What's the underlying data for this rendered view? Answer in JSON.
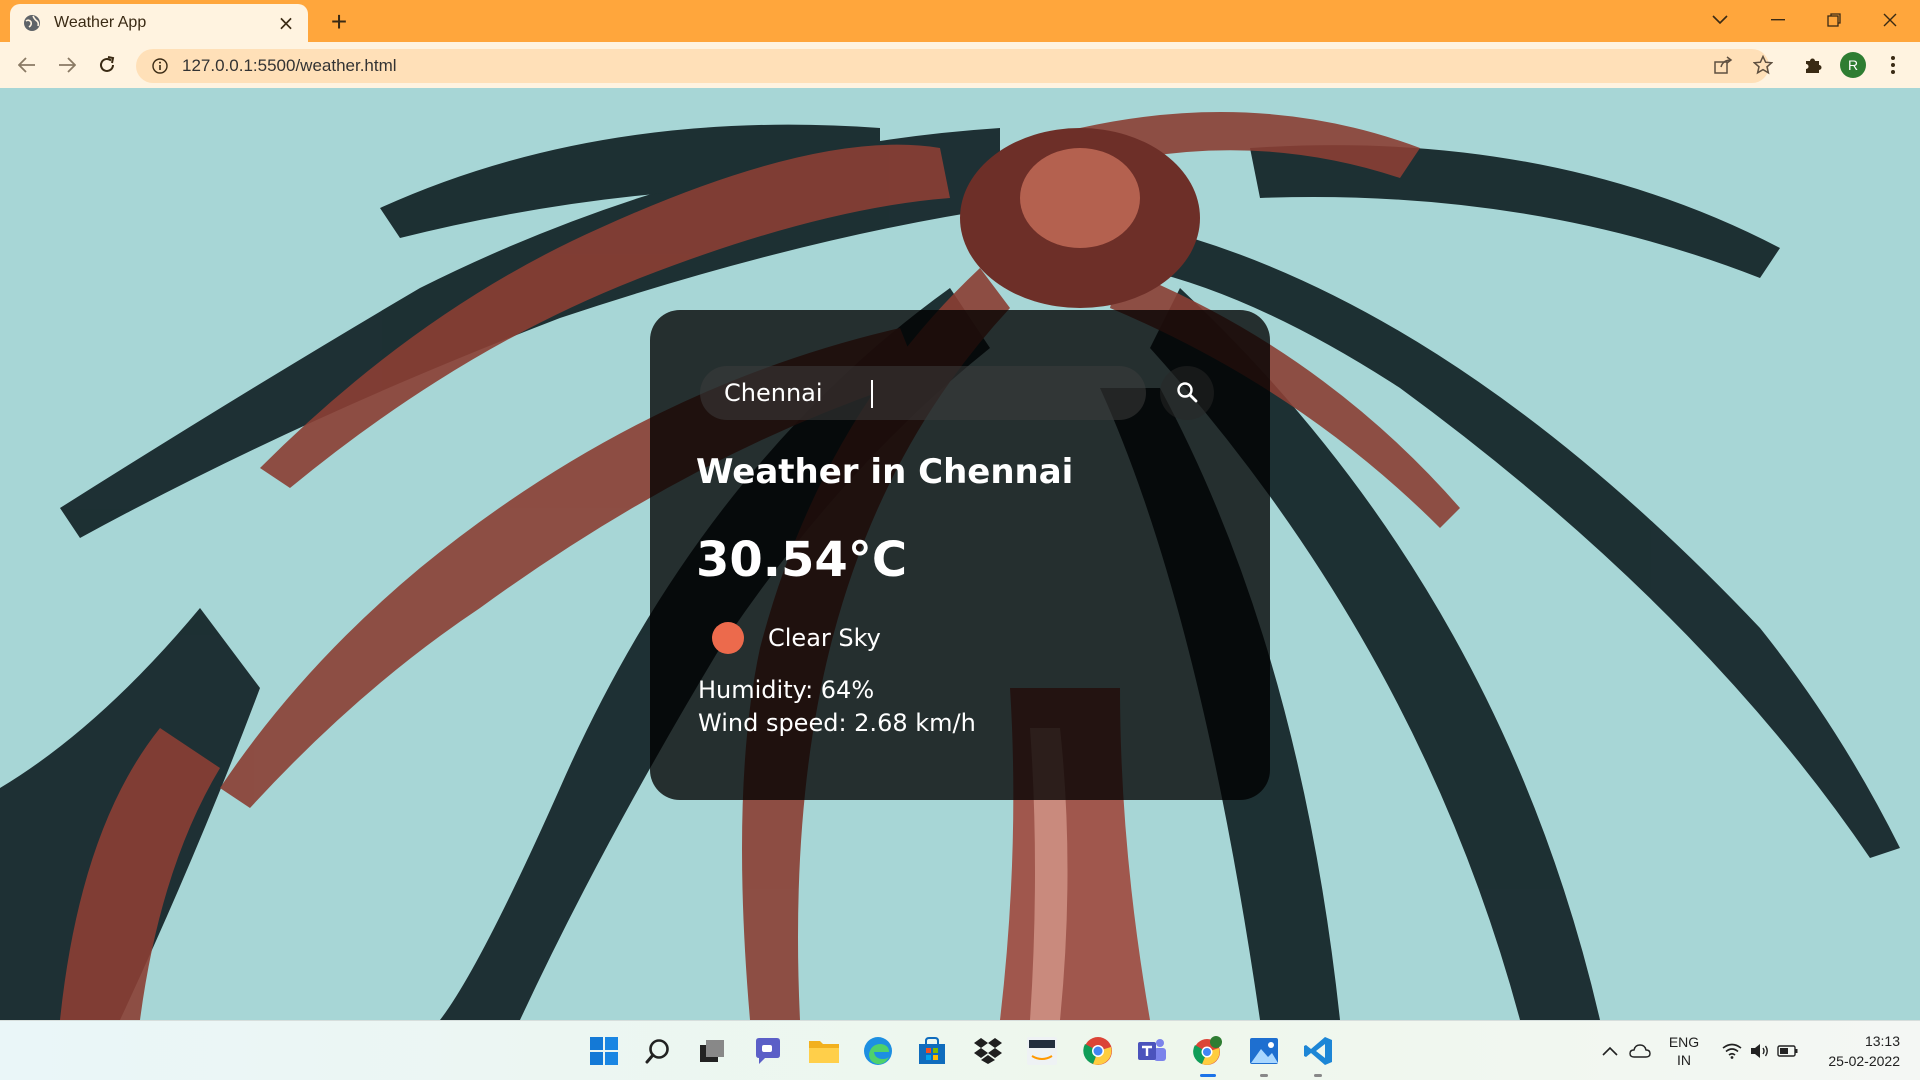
{
  "browser": {
    "tab_title": "Weather App",
    "tab_close": "×",
    "new_tab": "+",
    "url": "127.0.0.1:5500/weather.html",
    "profile_initial": "R",
    "theme_color": "#ffa63c"
  },
  "weather": {
    "search_value": "Chennai",
    "search_placeholder": "Search",
    "title": "Weather in Chennai",
    "temperature": "30.54°C",
    "condition": "Clear Sky",
    "condition_icon_color": "#ec6a4c",
    "humidity": "Humidity: 64%",
    "wind": "Wind speed: 2.68 km/h"
  },
  "taskbar": {
    "apps": [
      "start-icon",
      "search-icon",
      "task-view-icon",
      "teams-chat-icon",
      "file-explorer-icon",
      "edge-icon",
      "store-icon",
      "dropbox-icon",
      "amazon-icon",
      "chrome-icon",
      "teams-icon",
      "chrome-profile-icon",
      "photos-icon",
      "vscode-icon"
    ],
    "lang_top": "ENG",
    "lang_bottom": "IN",
    "time": "13:13",
    "date": "25-02-2022"
  }
}
